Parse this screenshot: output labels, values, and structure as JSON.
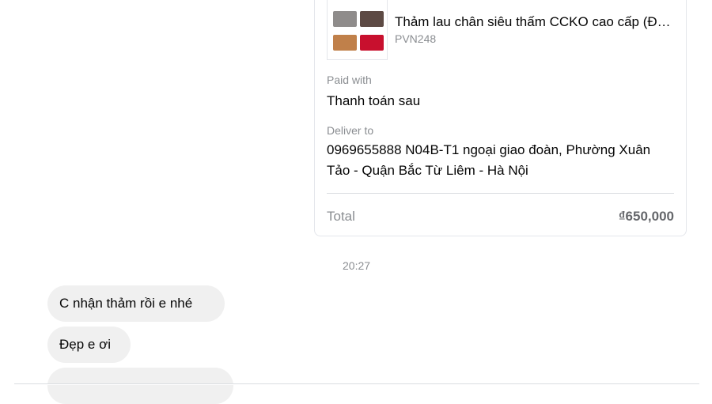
{
  "order": {
    "product_name": "Thảm lau chân siêu thấm CCKO cao cấp (Đ…",
    "product_code": "PVN248",
    "product_image": "mat-colors-thumbnail",
    "paid_label": "Paid with",
    "paid_value": "Thanh toán sau",
    "deliver_label": "Deliver to",
    "deliver_value": "0969655888 N04B-T1 ngoại giao đoàn, Phường Xuân Tảo - Quận Bắc Từ Liêm - Hà Nội",
    "total_label": "Total",
    "total_value": "₫650,000"
  },
  "chat": {
    "timestamp": "20:27",
    "messages": [
      {
        "text": "C nhận thảm rồi e nhé"
      },
      {
        "text": "Đẹp e ơi"
      },
      {
        "text": ""
      }
    ]
  },
  "colors": {
    "bubble_bg": "#f0f0f0",
    "border": "#e4e6eb",
    "muted_text": "#8a8d91",
    "mat_gray": "#8f8c8b",
    "mat_brown": "#5d4a44",
    "mat_tan": "#c0804a",
    "mat_red": "#c8102e"
  }
}
